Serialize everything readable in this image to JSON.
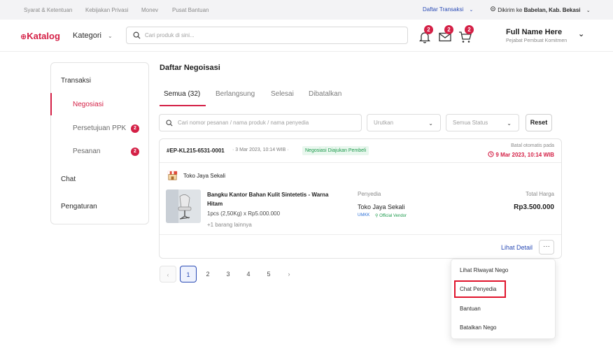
{
  "topbar": {
    "links": [
      "Syarat & Ketentuan",
      "Kebijakan Privasi",
      "Monev",
      "Pusat Bantuan"
    ],
    "transaksi_label": "Daftar Transaksi",
    "ship_prefix": "Dikirim ke",
    "ship_location": "Babelan, Kab. Bekasi"
  },
  "header": {
    "logo": "Katalog",
    "kategori_label": "Kategori",
    "search_placeholder": "Cari produk di sini...",
    "badges": {
      "notif": "2",
      "inbox": "2",
      "cart": "2"
    },
    "user_name": "Full Name Here",
    "user_role": "Pejabat Pembuat Komitmen"
  },
  "sidebar": {
    "transaksi": "Transaksi",
    "negosiasi": "Negosiasi",
    "persetujuan": "Persetujuan PPK",
    "persetujuan_badge": "2",
    "pesanan": "Pesanan",
    "pesanan_badge": "2",
    "chat": "Chat",
    "pengaturan": "Pengaturan"
  },
  "main": {
    "title": "Daftar Negoisasi",
    "tabs": [
      "Semua (32)",
      "Berlangsung",
      "Selesai",
      "Dibatalkan"
    ],
    "search_placeholder": "Cari nomor pesanan / nama produk / nama penyedia",
    "sort_placeholder": "Urutkan",
    "status_placeholder": "Semua Status",
    "reset_label": "Reset"
  },
  "order": {
    "id": "#EP-KL215-6531-0001",
    "date": "· 3 Mar 2023, 10:14 WIB ·",
    "status": "Negosiasi Diajukan Pembeli",
    "auto_cancel_label": "Batal otomatis pada",
    "deadline": "9 Mar 2023, 10:14 WIB",
    "store": "Toko Jaya Sekali",
    "product_name": "Bangku Kantor Bahan Kulit Sintetetis - Warna Hitam",
    "product_qty": "1pcs (2,50Kg) x Rp5.000.000",
    "more_items": "+1 barang lainnya",
    "provider_label": "Penyedia",
    "provider_name": "Toko Jaya Sekali",
    "umkk_tag": "UMKK",
    "official_tag": "Official Vendor",
    "total_label": "Total Harga",
    "total_value": "Rp3.500.000",
    "detail_link": "Lihat Detail",
    "more_button": "···"
  },
  "pagination": {
    "prev": "‹",
    "pages": [
      "1",
      "2",
      "3",
      "4",
      "5"
    ],
    "next": "›",
    "current": "1"
  },
  "menu": {
    "items": [
      "Lihat Riwayat Nego",
      "Chat Penyedia",
      "Bantuan",
      "Batalkan Nego"
    ],
    "highlighted": "Chat Penyedia"
  },
  "colors": {
    "brand": "#d42046",
    "link": "#2a4bb5",
    "success": "#1b9a4b",
    "highlight_box": "#e0142c"
  }
}
